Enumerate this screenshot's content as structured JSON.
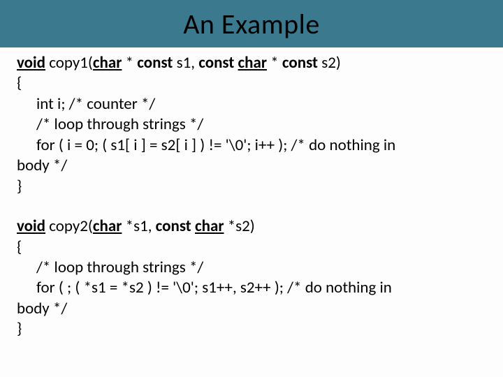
{
  "header": {
    "title": "An Example"
  },
  "code1": {
    "sig_void": "void",
    "sig_fn": " copy1(",
    "sig_char1": "char",
    "sig_p1": " * ",
    "sig_const1": "const",
    "sig_s1": " s1, ",
    "sig_const2": "const",
    "sig_sp2": " ",
    "sig_char2": "char",
    "sig_p2": " * ",
    "sig_const3": "const",
    "sig_s2": " s2)",
    "open": "{",
    "l1": " int i; /* counter */",
    "l2": " /* loop through strings */",
    "l3": " for ( i = 0; ( s1[ i ] = s2[ i ] ) != '\\0'; i++ ); /* do nothing in",
    "l4": "body */",
    "close": "}"
  },
  "code2": {
    "sig_void": "void",
    "sig_fn": " copy2(",
    "sig_char1": "char",
    "sig_s1": " *s1, ",
    "sig_const1": "const",
    "sig_sp1": " ",
    "sig_char2": "char",
    "sig_s2": " *s2)",
    "open": "{",
    "l1": " /* loop through strings */",
    "l2": " for ( ; ( *s1 = *s2 ) != '\\0'; s1++, s2++ ); /* do nothing in",
    "l3": "body */",
    "close": "}"
  }
}
